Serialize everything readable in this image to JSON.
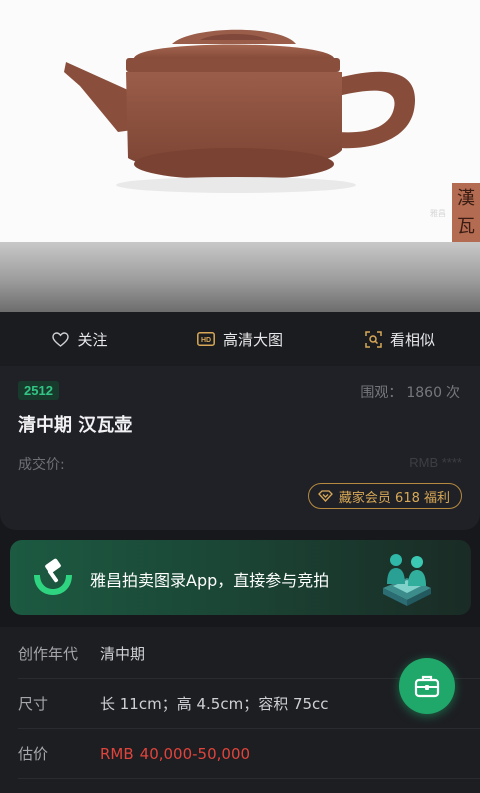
{
  "image": {
    "seal_chars": [
      "漢",
      "瓦"
    ],
    "seal_mark": "雅昌"
  },
  "actions": [
    {
      "label": "关注",
      "icon": "heart-outline-icon"
    },
    {
      "label": "高清大图",
      "icon": "hd-icon"
    },
    {
      "label": "看相似",
      "icon": "scan-similar-icon"
    }
  ],
  "lot": {
    "number": "2512",
    "views_prefix": "围观：",
    "views_count": "1860",
    "views_suffix": "次",
    "title": "清中期 汉瓦壶",
    "price_label": "成交价:",
    "price_value": "RMB ****",
    "member_badge": "藏家会员 618 福利"
  },
  "promo": {
    "text": "雅昌拍卖图录App，直接参与竞拍"
  },
  "details": {
    "era_label": "创作年代",
    "era_value": "清中期",
    "size_label": "尺寸",
    "size_value": "长 11cm；高 4.5cm；容积 75cc",
    "estimate_label": "估价",
    "estimate_currency": "RMB",
    "estimate_value": "40,000-50,000"
  },
  "colors": {
    "accent_green": "#1fa86a",
    "lot_badge_text": "#33c585",
    "gold": "#d7a857",
    "estimate_red": "#e0443c",
    "teapot": "#8e5341"
  }
}
